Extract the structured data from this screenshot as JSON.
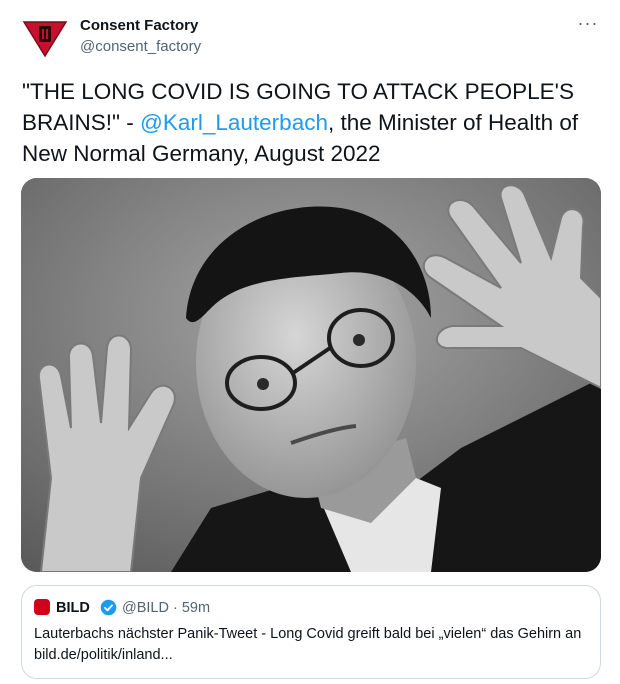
{
  "author": {
    "display_name": "Consent Factory",
    "handle": "@consent_factory"
  },
  "more_label": "···",
  "tweet": {
    "text_before": "\"THE LONG COVID IS GOING TO ATTACK PEOPLE'S BRAINS!\" - ",
    "mention": "@Karl_Lauterbach",
    "text_after": ", the Minister of Health of New Normal Germany, August 2022"
  },
  "quote_tweet": {
    "display_name": "BILD",
    "handle_time": "@BILD · 59m",
    "text": "Lauterbachs nächster Panik-Tweet - Long Covid greift bald bei „vielen“ das Gehirn an bild.de/politik/inland..."
  },
  "colors": {
    "accent": "#1d9bf0",
    "avatar_red": "#c8102e",
    "bild_red": "#d0021b",
    "text_secondary": "#536471"
  }
}
